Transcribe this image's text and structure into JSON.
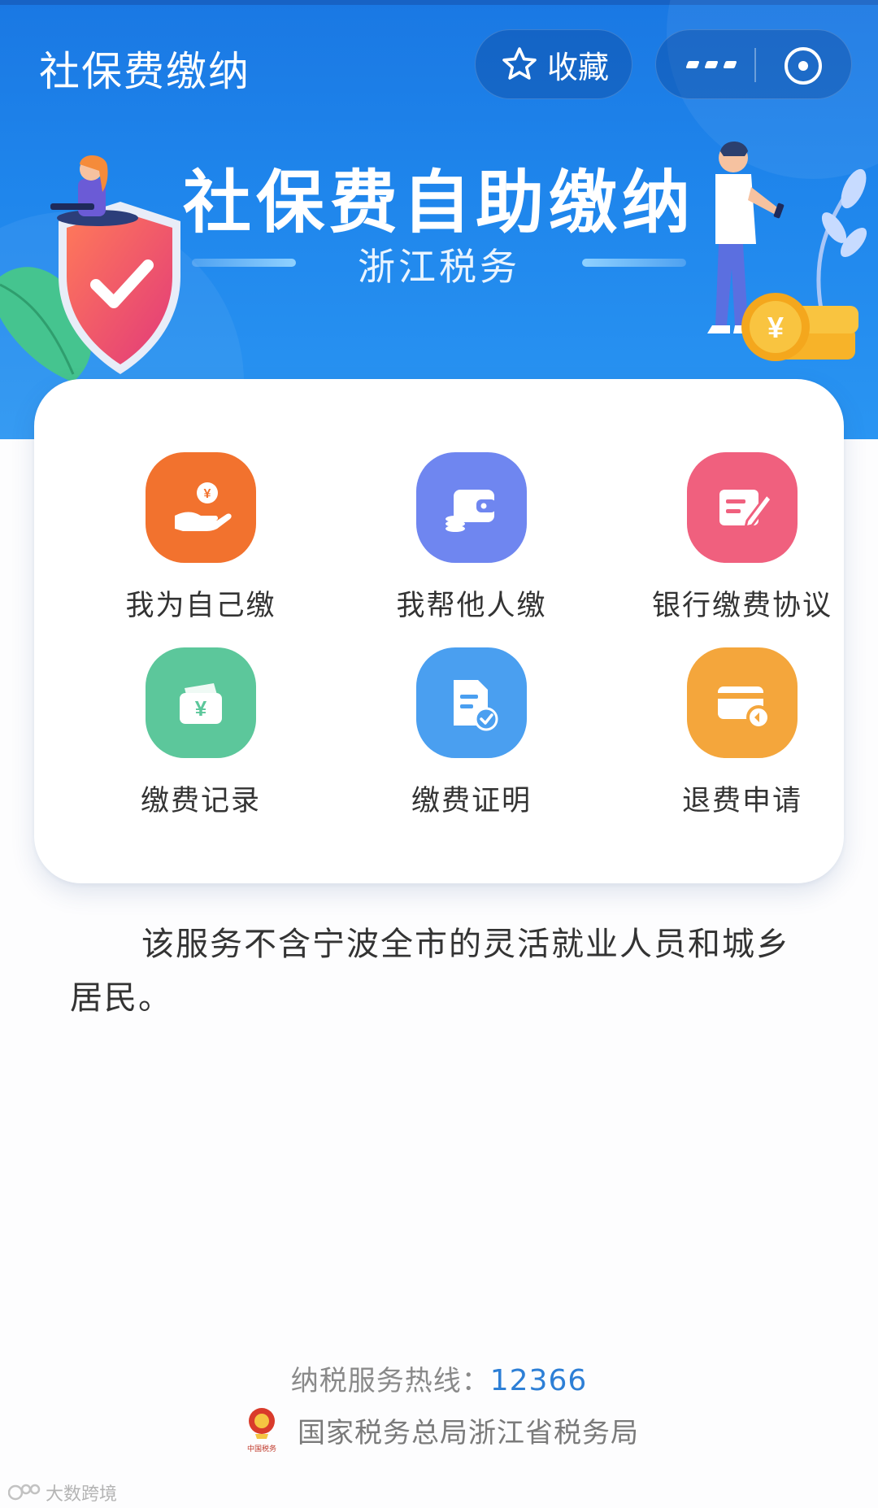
{
  "nav": {
    "title": "社保费缴纳",
    "favorite_label": "收藏",
    "more_icon": "more-dots-icon",
    "close_icon": "mini-program-close-icon"
  },
  "banner": {
    "title": "社保费自助缴纳",
    "subtitle": "浙江税务"
  },
  "services": [
    {
      "label": "我为自己缴",
      "icon": "hand-coin-icon",
      "color": "#f2722e"
    },
    {
      "label": "我帮他人缴",
      "icon": "wallet-icon",
      "color": "#6f86f0"
    },
    {
      "label": "银行缴费协议",
      "icon": "edit-document-icon",
      "color": "#f0607e"
    },
    {
      "label": "缴费记录",
      "icon": "money-envelope-icon",
      "color": "#5cc79b"
    },
    {
      "label": "缴费证明",
      "icon": "certificate-check-icon",
      "color": "#4a9ff0"
    },
    {
      "label": "退费申请",
      "icon": "card-refund-icon",
      "color": "#f4a63c"
    }
  ],
  "notice": "该服务不含宁波全市的灵活就业人员和城乡居民。",
  "footer": {
    "hotline_label": "纳税服务热线：",
    "hotline_number": "12366",
    "org_name": "国家税务总局浙江省税务局",
    "emblem_caption": "中国税务"
  },
  "watermark": "大数跨境",
  "colors": {
    "header_blue": "#1f86ec",
    "link_blue": "#2d7fd6"
  }
}
